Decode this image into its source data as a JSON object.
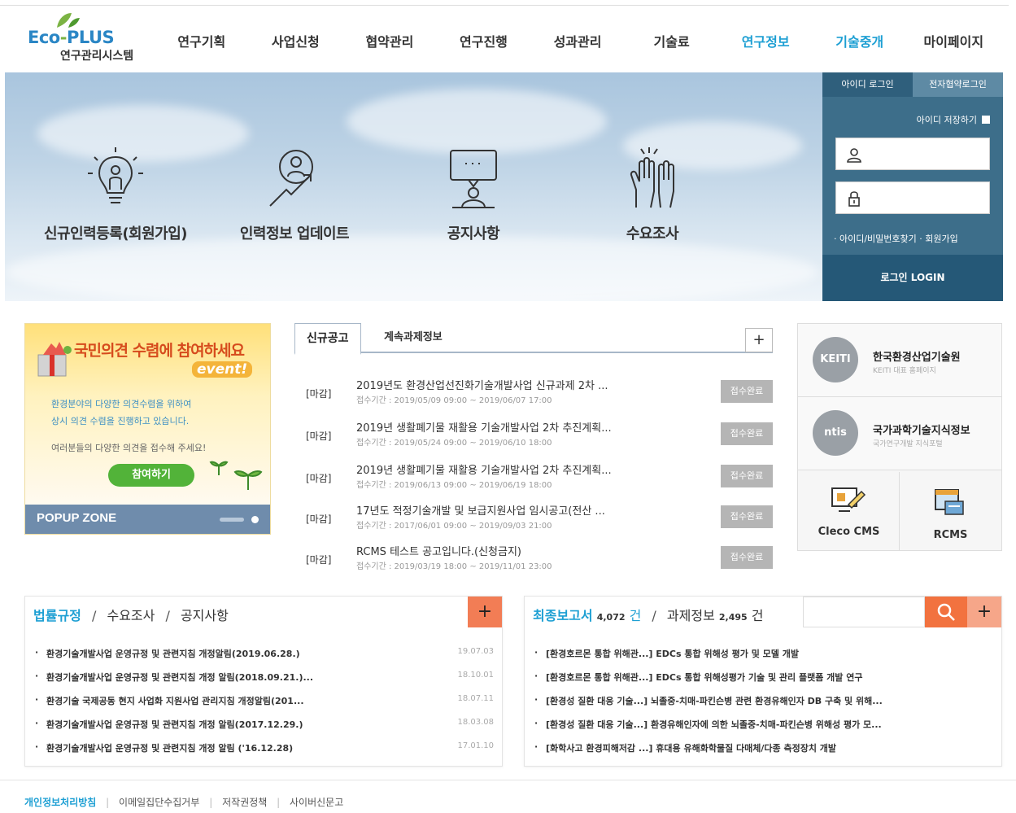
{
  "logo": {
    "brand_a": "Eco",
    "brand_dash": "-",
    "brand_b": "PLUS",
    "subtitle": "연구관리시스템"
  },
  "nav": [
    {
      "label": "연구기획",
      "highlight": false
    },
    {
      "label": "사업신청",
      "highlight": false
    },
    {
      "label": "협약관리",
      "highlight": false
    },
    {
      "label": "연구진행",
      "highlight": false
    },
    {
      "label": "성과관리",
      "highlight": false
    },
    {
      "label": "기술료",
      "highlight": false
    },
    {
      "label": "연구정보",
      "highlight": true
    },
    {
      "label": "기술중개",
      "highlight": true
    },
    {
      "label": "마이페이지",
      "highlight": false
    }
  ],
  "hero": {
    "quick": [
      {
        "label": "신규인력등록(회원가입)",
        "icon": "lightbulb-person-icon"
      },
      {
        "label": "인력정보 업데이트",
        "icon": "person-arrow-icon"
      },
      {
        "label": "공지사항",
        "icon": "speech-board-icon"
      },
      {
        "label": "수요조사",
        "icon": "raised-hands-icon"
      }
    ]
  },
  "login": {
    "tab_id": "아이디 로그인",
    "tab_cert": "전자협약로그인",
    "save_id": "아이디 저장하기",
    "find": "· 아이디/비밀번호찾기 · 회원가입",
    "button": "로그인 LOGIN"
  },
  "popup": {
    "title": "국민의견 수렴에 참여하세요",
    "event": "event!",
    "line1": "환경분야의 다양한 의견수렴을 위하여",
    "line2": "상시 의견 수렴을 진행하고 있습니다.",
    "line3": "여러분들의 다양한 의견을 접수해 주세요!",
    "join": "참여하기",
    "zone": "POPUP ZONE"
  },
  "notice": {
    "tab_new": "신규공고",
    "tab_cont": "계속과제정보",
    "more": "+",
    "items": [
      {
        "tag": "[마감]",
        "title": "2019년도 환경산업선진화기술개발사업 신규과제 2차 ...",
        "period": "접수기간 : 2019/05/09 09:00 ~ 2019/06/07 17:00",
        "status": "접수완료"
      },
      {
        "tag": "[마감]",
        "title": "2019년 생활폐기물 재활용 기술개발사업 2차 추진계획...",
        "period": "접수기간 : 2019/05/24 09:00 ~ 2019/06/10 18:00",
        "status": "접수완료"
      },
      {
        "tag": "[마감]",
        "title": "2019년 생활폐기물 재활용 기술개발사업 2차 추진계획...",
        "period": "접수기간 : 2019/06/13 09:00 ~ 2019/06/19 18:00",
        "status": "접수완료"
      },
      {
        "tag": "[마감]",
        "title": "17년도 적정기술개발 및 보급지원사업 임시공고(전산 ...",
        "period": "접수기간 : 2017/06/01 09:00 ~ 2019/09/03 21:00",
        "status": "접수완료"
      },
      {
        "tag": "[마감]",
        "title": "RCMS 테스트 공고입니다.(신청금지)",
        "period": "접수기간 : 2019/03/19 18:00 ~ 2019/11/01 23:00",
        "status": "접수완료"
      }
    ]
  },
  "orgs": {
    "keiti": {
      "logo": "KEITI",
      "name": "한국환경산업기술원",
      "sub": "KEITI 대표 홈페이지"
    },
    "ntis": {
      "logo": "ntis",
      "name": "국가과학기술지식정보",
      "sub": "국가연구개발 지식포털"
    },
    "cms": "Cleco CMS",
    "rcms": "RCMS"
  },
  "board_left": {
    "tab1": "법률규정",
    "sep": "/",
    "tab2": "수요조사",
    "tab3": "공지사항",
    "more": "+",
    "items": [
      {
        "text": "환경기술개발사업 운영규정 및 관련지침 개정알림(2019.06.28.)",
        "date": "19.07.03"
      },
      {
        "text": "환경기술개발사업 운영규정 및 관련지침 개정 알림(2018.09.21.)...",
        "date": "18.10.01"
      },
      {
        "text": "환경기술 국제공동 현지 사업화 지원사업 관리지침 개정알림(201...",
        "date": "18.07.11"
      },
      {
        "text": "환경기술개발사업 운영규정 및 관련지침 개정 알림(2017.12.29.)",
        "date": "18.03.08"
      },
      {
        "text": "환경기술개발사업 운영규정 및 관련지침 개정 알림 ('16.12.28)",
        "date": "17.01.10"
      }
    ]
  },
  "board_right": {
    "tab1": "최종보고서",
    "count1": "4,072",
    "unit1": "건",
    "sep": "/",
    "tab2": "과제정보",
    "count2": "2,495",
    "unit2": "건",
    "more": "+",
    "items": [
      {
        "text": "[환경호르몬 통합 위해관...] EDCs 통합 위해성 평가 및 모델 개발"
      },
      {
        "text": "[환경호르몬 통합 위해관...] EDCs 통합 위해성평가 기술 및 관리 플랫폼 개발 연구"
      },
      {
        "text": "[환경성 질환 대응 기술...] 뇌졸중-치매-파킨슨병 관련 환경유해인자 DB 구축 및 위해..."
      },
      {
        "text": "[환경성 질환 대응 기술...] 환경유해인자에 의한 뇌졸중-치매-파킨슨병 위해성 평가 모..."
      },
      {
        "text": "[화학사고 환경피해저감 ...] 휴대용 유해화학물질 다매체/다종 측정장치 개발"
      }
    ]
  },
  "footer": {
    "privacy": "개인정보처리방침",
    "email": "이메일집단수집거부",
    "copyright": "저작권정책",
    "cyber": "사이버신문고",
    "bar": "|"
  },
  "colors": {
    "accent": "#1d9fd3",
    "orange": "#f27d55",
    "login_bg": "#3d6e8a"
  }
}
